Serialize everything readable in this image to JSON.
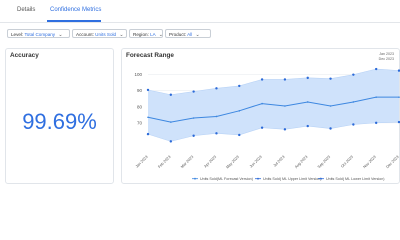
{
  "tabs": [
    {
      "label": "Details"
    },
    {
      "label": "Confidence Metrics"
    }
  ],
  "filters": {
    "level": {
      "label": "Level:",
      "value": "Total Company"
    },
    "account": {
      "label": "Account:",
      "value": "Units Sold"
    },
    "region": {
      "label": "Region:",
      "value": "LA"
    },
    "product": {
      "label": "Product:",
      "value": "All"
    }
  },
  "accuracy_card": {
    "title": "Accuracy",
    "value": "99.69%"
  },
  "forecast_card": {
    "title": "Forecast Range",
    "date_start": "Jan 2023",
    "date_end": "Dec 2023"
  },
  "colors": {
    "accent": "#2f6fe0",
    "band": "#cfe2fb",
    "line": "#3d87e0",
    "dot": "#2c6ad8"
  },
  "chart_data": {
    "type": "area",
    "title": "Forecast Range",
    "categories": [
      "Jan 2023",
      "Feb 2023",
      "Mar 2023",
      "Apr 2023",
      "May 2023",
      "Jun 2023",
      "Jul 2023",
      "Aug 2023",
      "Sep 2023",
      "Oct 2023",
      "Nov 2023",
      "Dec 2023"
    ],
    "series": [
      {
        "name": "Units Sold(ML Forecast Version)",
        "values": [
          73.5,
          70.5,
          73.0,
          74.0,
          77.5,
          82.0,
          80.5,
          83.0,
          80.5,
          83.0,
          86.0,
          86.0
        ]
      },
      {
        "name": "Units Sold( ML Upper Limit Version)",
        "values": [
          90.5,
          87.5,
          89.5,
          91.5,
          93.0,
          97.0,
          97.0,
          98.0,
          97.5,
          100.0,
          103.5,
          102.5
        ]
      },
      {
        "name": "Units Sold( ML Lower Limit Version)",
        "values": [
          63.0,
          58.5,
          62.0,
          63.5,
          62.5,
          67.0,
          66.0,
          68.0,
          66.5,
          69.0,
          70.0,
          70.5
        ]
      }
    ],
    "yticks": [
      70,
      80,
      90,
      100
    ],
    "ylim": [
      55,
      106
    ],
    "grid": true,
    "legend": "bottom"
  }
}
